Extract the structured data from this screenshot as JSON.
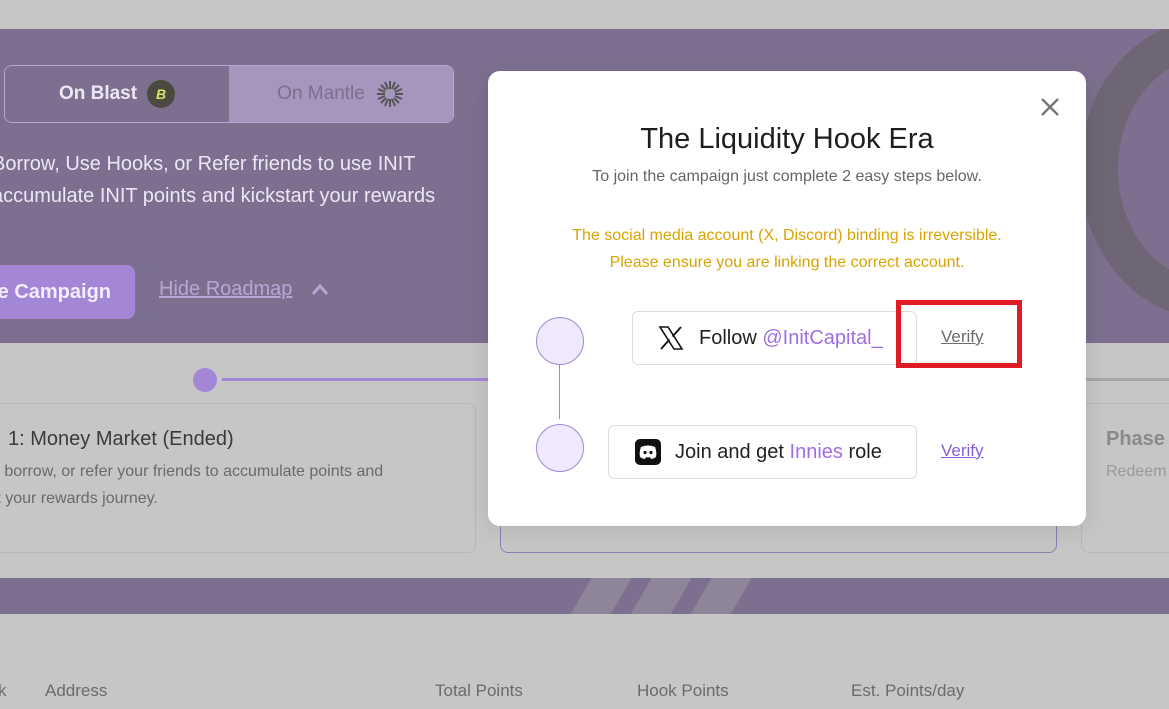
{
  "network_toggle": {
    "blast_label": "On Blast",
    "blast_icon_glyph": "B",
    "mantle_label": "On Mantle"
  },
  "hero": {
    "line1": "Borrow, Use Hooks, or Refer friends to use INIT",
    "line2": "accumulate INIT points and kickstart your rewards",
    "campaign_button": "e Campaign",
    "roadmap_link": "Hide Roadmap"
  },
  "phases": [
    {
      "title": "1: Money Market (Ended)",
      "desc_line1": "t, borrow, or refer your friends to accumulate points and",
      "desc_line2": "rt your rewards journey."
    },
    {
      "title": "Phase",
      "desc_line1": "Redeem"
    }
  ],
  "table_headers": [
    "k",
    "Address",
    "Total Points",
    "Hook Points",
    "Est. Points/day"
  ],
  "modal": {
    "title": "The Liquidity Hook Era",
    "subtitle": "To join the campaign just complete 2 easy steps below.",
    "warning_line1": "The social media account (X, Discord) binding is irreversible.",
    "warning_line2": "Please ensure you are linking the correct account.",
    "step1": {
      "prefix": "Follow",
      "handle": "@InitCapital_",
      "verify_label": "Verify",
      "icon": "x-logo-icon"
    },
    "step2": {
      "prefix": "Join and get",
      "role": "Innies",
      "suffix": "role",
      "verify_label": "Verify",
      "icon": "discord-logo-icon"
    }
  },
  "colors": {
    "accent": "#a386d6",
    "hero_bg": "#7d6f8f",
    "warning": "#d9a300",
    "highlight": "#e01b24"
  }
}
